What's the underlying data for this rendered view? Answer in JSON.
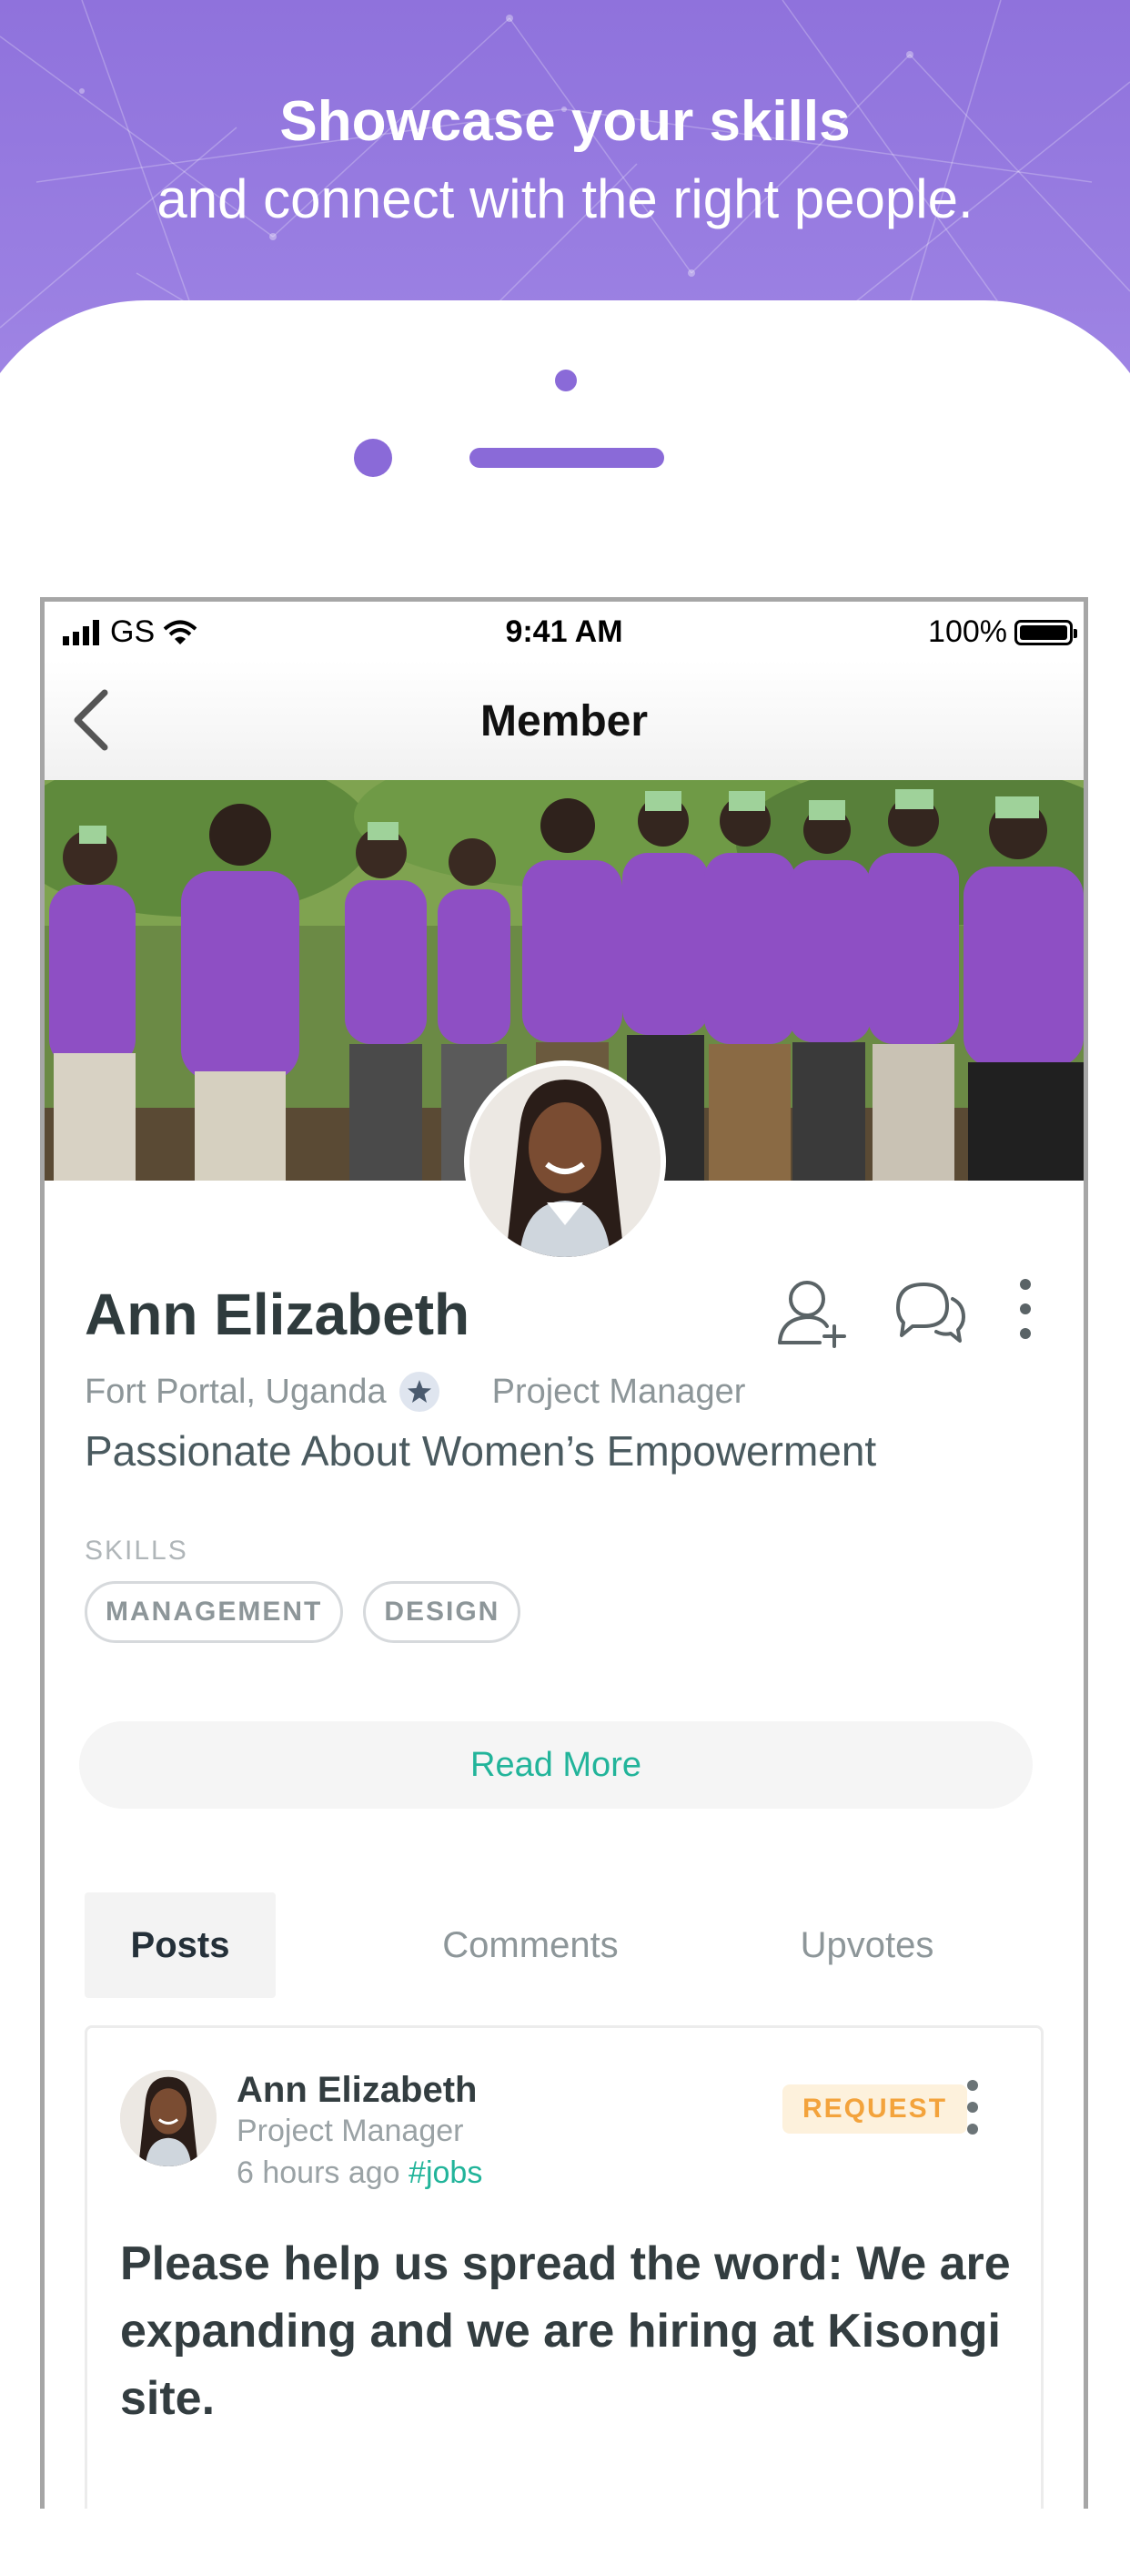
{
  "promo": {
    "headline_bold": "Showcase your skills",
    "headline_regular": "and connect with the right people."
  },
  "status_bar": {
    "carrier": "GS",
    "time": "9:41 AM",
    "battery": "100%"
  },
  "nav": {
    "title": "Member",
    "back_icon": "chevron-left-icon"
  },
  "profile": {
    "name": "Ann Elizabeth",
    "location": "Fort Portal, Uganda",
    "job_title": "Project Manager",
    "tagline": "Passionate About Women’s Empowerment",
    "skills_label": "SKILLS",
    "skills": [
      "MANAGEMENT",
      "DESIGN"
    ],
    "read_more": "Read More",
    "actions": [
      "add-friend-icon",
      "chat-icon",
      "more-vertical-icon"
    ]
  },
  "tabs": [
    {
      "label": "Posts",
      "active": true
    },
    {
      "label": "Comments",
      "active": false
    },
    {
      "label": "Upvotes",
      "active": false
    }
  ],
  "post": {
    "author": "Ann Elizabeth",
    "role": "Project Manager",
    "time": "6 hours ago",
    "hashtag": "#jobs",
    "badge": "REQUEST",
    "body": "Please help us spread the word: We are expanding and we are hiring at Kisongi site."
  },
  "colors": {
    "brand_purple": "#8a6ad8",
    "accent_green": "#22b49a",
    "badge_orange": "#f3a33c",
    "shirt_purple": "#8e4fc4"
  }
}
